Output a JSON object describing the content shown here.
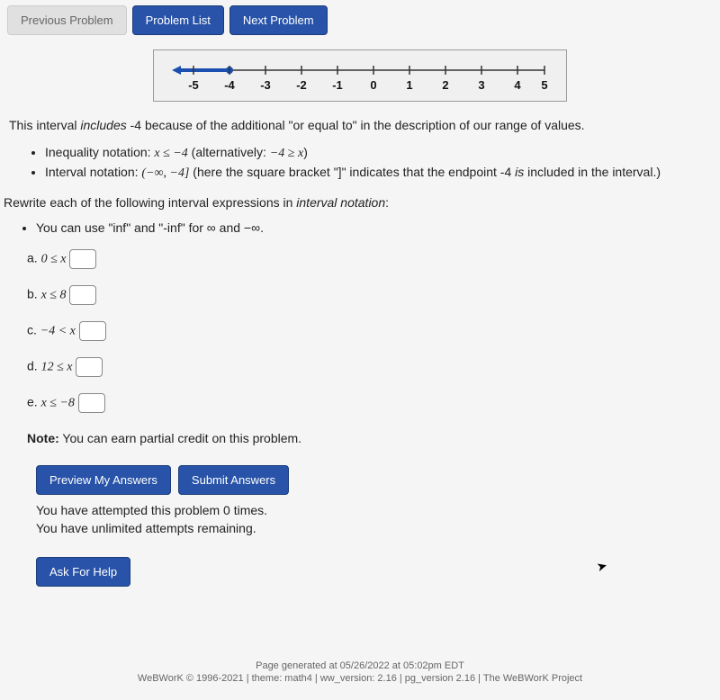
{
  "nav": {
    "prev": "Previous Problem",
    "list": "Problem List",
    "next": "Next Problem"
  },
  "numberline": {
    "ticks": [
      "-5",
      "-4",
      "-3",
      "-2",
      "-1",
      "0",
      "1",
      "2",
      "3",
      "4",
      "5"
    ]
  },
  "intro": "This interval includes -4 because of the additional \"or equal to\" in the description of our range of values.",
  "notation": {
    "ineq_prefix": "Inequality notation: ",
    "ineq_math": "x ≤ −4",
    "ineq_alt": " (alternatively: ",
    "ineq_alt_math": "−4 ≥ x",
    "ineq_close": ")",
    "interval_prefix": "Interval notation: ",
    "interval_math": "(−∞, −4]",
    "interval_explain": " (here the square bracket \"]\" indicates that the endpoint -4 ",
    "interval_is": "is",
    "interval_tail": " included in the interval.)"
  },
  "rewrite": "Rewrite each of the following interval expressions in ",
  "rewrite_em": "interval notation",
  "rewrite_colon": ":",
  "hint": "You can use \"inf\" and \"-inf\" for ∞ and −∞.",
  "questions": {
    "a_label": "a.  ",
    "a_math": "0 ≤ x",
    "b_label": "b.  ",
    "b_math": "x ≤ 8",
    "c_label": "c.  ",
    "c_math": "−4 < x",
    "d_label": "d.  ",
    "d_math": "12 ≤ x",
    "e_label": "e.  ",
    "e_math": "x ≤ −8"
  },
  "note_bold": "Note:",
  "note_text": " You can earn partial credit on this problem.",
  "actions": {
    "preview": "Preview My Answers",
    "submit": "Submit Answers",
    "help": "Ask For Help"
  },
  "attempts": {
    "line1": "You have attempted this problem 0 times.",
    "line2": "You have unlimited attempts remaining."
  },
  "footer": {
    "line1": "Page generated at 05/26/2022 at 05:02pm EDT",
    "line2": "WeBWorK © 1996-2021 | theme: math4 | ww_version: 2.16 | pg_version 2.16 | The WeBWorK Project"
  }
}
